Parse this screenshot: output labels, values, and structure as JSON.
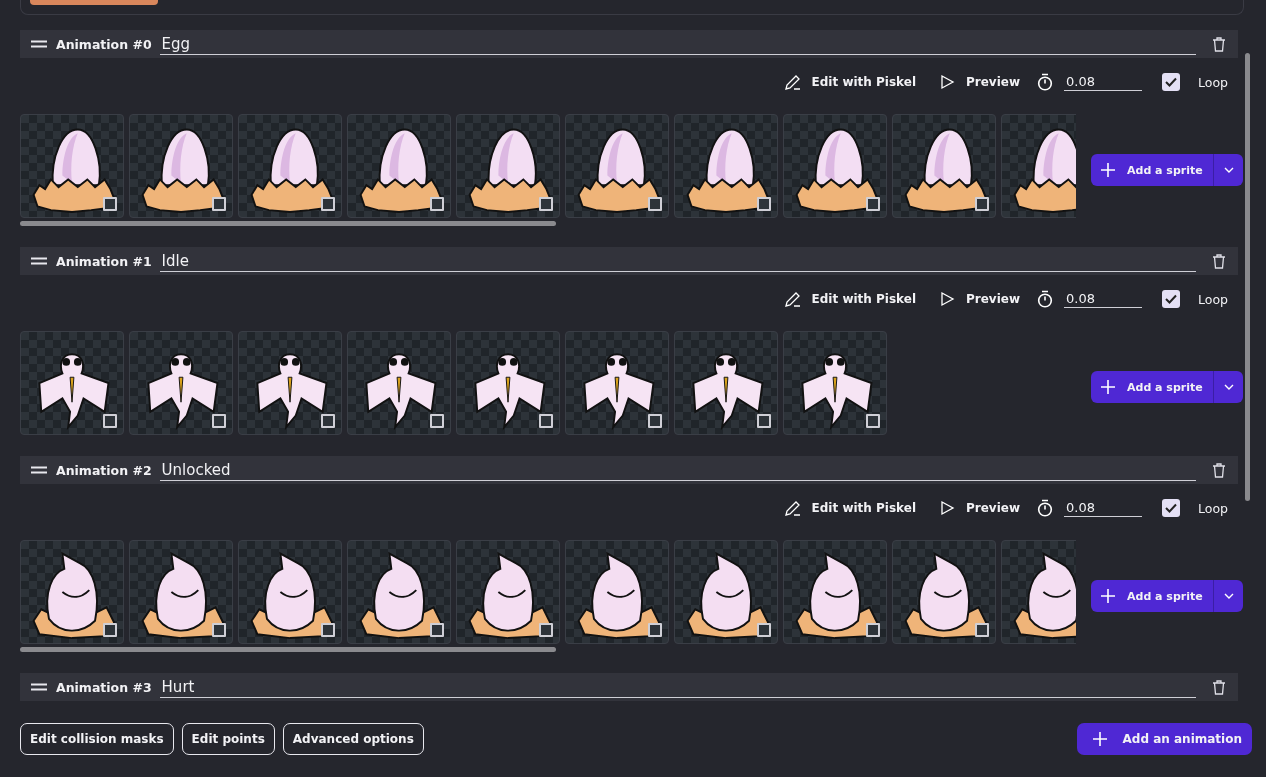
{
  "animations": [
    {
      "label": "Animation #0",
      "name": "Egg",
      "edit_label": "Edit with Piskel",
      "preview_label": "Preview",
      "duration": "0.08",
      "loop": true,
      "loop_label": "Loop",
      "add_label": "Add a sprite",
      "kind": "egg",
      "overflow": true,
      "frames": [
        {
          "checked": false
        },
        {
          "checked": false
        },
        {
          "checked": false
        },
        {
          "checked": false
        },
        {
          "checked": false
        },
        {
          "checked": false
        },
        {
          "checked": false
        },
        {
          "checked": false
        },
        {
          "checked": false
        }
      ]
    },
    {
      "label": "Animation #1",
      "name": "Idle",
      "edit_label": "Edit with Piskel",
      "preview_label": "Preview",
      "duration": "0.08",
      "loop": true,
      "loop_label": "Loop",
      "add_label": "Add a sprite",
      "kind": "creature",
      "frames": [
        {
          "checked": false
        },
        {
          "checked": false
        },
        {
          "checked": false
        },
        {
          "checked": false
        },
        {
          "checked": false
        },
        {
          "checked": false
        },
        {
          "checked": false
        },
        {
          "checked": false
        }
      ]
    },
    {
      "label": "Animation #2",
      "name": "Unlocked",
      "edit_label": "Edit with Piskel",
      "preview_label": "Preview",
      "duration": "0.08",
      "loop": true,
      "loop_label": "Loop",
      "add_label": "Add a sprite",
      "kind": "hatchling",
      "overflow": true,
      "frames": [
        {
          "checked": false
        },
        {
          "checked": false
        },
        {
          "checked": false
        },
        {
          "checked": false
        },
        {
          "checked": false
        },
        {
          "checked": false
        },
        {
          "checked": false
        },
        {
          "checked": false
        },
        {
          "checked": false
        }
      ]
    },
    {
      "label": "Animation #3",
      "name": "Hurt"
    }
  ],
  "bottom_buttons": [
    "Edit collision masks",
    "Edit points",
    "Advanced options"
  ],
  "add_animation": "Add an animation"
}
